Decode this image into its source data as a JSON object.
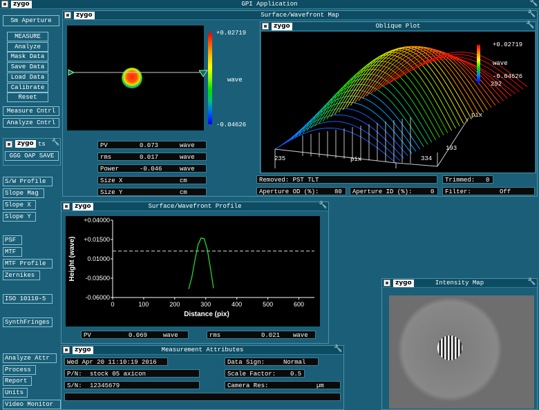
{
  "app": {
    "title": "GPI Application",
    "logo": "zygo"
  },
  "sidebar": {
    "aperture": "Sm Aperture",
    "buttons": [
      "MEASURE",
      "Analyze",
      "Mask Data",
      "Save Data",
      "Load Data",
      "Calibrate",
      "Reset"
    ],
    "measure_cntrl": "Measure Cntrl",
    "analyze_cntrl": "Analyze Cntrl",
    "results_panel": {
      "title_suffix": "ts",
      "item": "GGG OAP SAVE"
    },
    "analysis_buttons": [
      "S/W Profile",
      "Slope Mag",
      "Slope X",
      "Slope Y"
    ],
    "optics_buttons": [
      "PSF",
      "MTF",
      "MTF Profile",
      "Zernikes"
    ],
    "iso": "ISO 10110-5",
    "synth": "SynthFringes",
    "bottom_buttons": [
      "Analyze Attr",
      "Process",
      "Report",
      "Units",
      "Video Monitor"
    ]
  },
  "surface_map": {
    "title": "Surface/Wavefront Map",
    "scale_max": "+0.02719",
    "scale_unit": "wave",
    "scale_min": "-0.04626",
    "results": [
      {
        "label": "PV",
        "value": "0.073",
        "unit": "wave"
      },
      {
        "label": "rms",
        "value": "0.017",
        "unit": "wave"
      },
      {
        "label": "Power",
        "value": "-0.046",
        "unit": "wave"
      },
      {
        "label": "Size X",
        "value": "",
        "unit": "cm"
      },
      {
        "label": "Size Y",
        "value": "",
        "unit": "cm"
      }
    ]
  },
  "oblique_plot": {
    "title": "Oblique Plot",
    "scale_max": "+0.02719",
    "scale_unit": "wave",
    "scale_min": "-0.04626",
    "y_top": "292",
    "y_unit": "pix",
    "y_bottom": "193",
    "x_left": "235",
    "x_unit": "pix",
    "x_right": "334"
  },
  "status": {
    "removed": "Removed: PST TLT",
    "trimmed_label": "Trimmed:",
    "trimmed_value": "0",
    "aperture_od_label": "Aperture OD (%):",
    "aperture_od_value": "80",
    "aperture_id_label": "Aperture ID (%):",
    "aperture_id_value": "0",
    "filter_label": "Filter:",
    "filter_value": "Off"
  },
  "profile": {
    "title": "Surface/Wavefront Profile",
    "pv": {
      "label": "PV",
      "value": "0.069",
      "unit": "wave"
    },
    "rms": {
      "label": "rms",
      "value": "0.021",
      "unit": "wave"
    }
  },
  "chart_data": {
    "type": "line",
    "xlabel": "Distance (pix)",
    "ylabel": "Height (wave)",
    "xlim": [
      0,
      650
    ],
    "ylim": [
      -0.06,
      0.04
    ],
    "x_ticks": [
      "0",
      "100",
      "200",
      "300",
      "400",
      "500",
      "600"
    ],
    "y_ticks": [
      "+0.04000",
      "+0.01500",
      "0.01000",
      "-0.03500",
      "-0.06000"
    ],
    "series": [
      {
        "values": [
          [
            245,
            -0.049
          ],
          [
            255,
            -0.034
          ],
          [
            265,
            -0.012
          ],
          [
            275,
            0.008
          ],
          [
            285,
            0.017
          ],
          [
            295,
            0.016
          ],
          [
            305,
            0.002
          ],
          [
            315,
            -0.022
          ],
          [
            325,
            -0.048
          ]
        ]
      }
    ],
    "reference_line": 0.0
  },
  "measurement": {
    "title": "Measurement Attributes",
    "date": "Wed Apr 20 11:10:19 2016",
    "pn_label": "P/N:",
    "pn_value": "stock 05 axicon",
    "sn_label": "S/N:",
    "sn_value": "12345679",
    "data_sign_label": "Data Sign:",
    "data_sign_value": "Normal",
    "scale_factor_label": "Scale Factor:",
    "scale_factor_value": "0.5",
    "camera_res_label": "Camera Res:",
    "camera_res_unit": "µm"
  },
  "intensity": {
    "title": "Intensity Map"
  },
  "colors": {
    "bg": "#1a5f77",
    "title_bg": "#0d4c62",
    "plot_green": "#2ee82e",
    "black": "#000000"
  }
}
